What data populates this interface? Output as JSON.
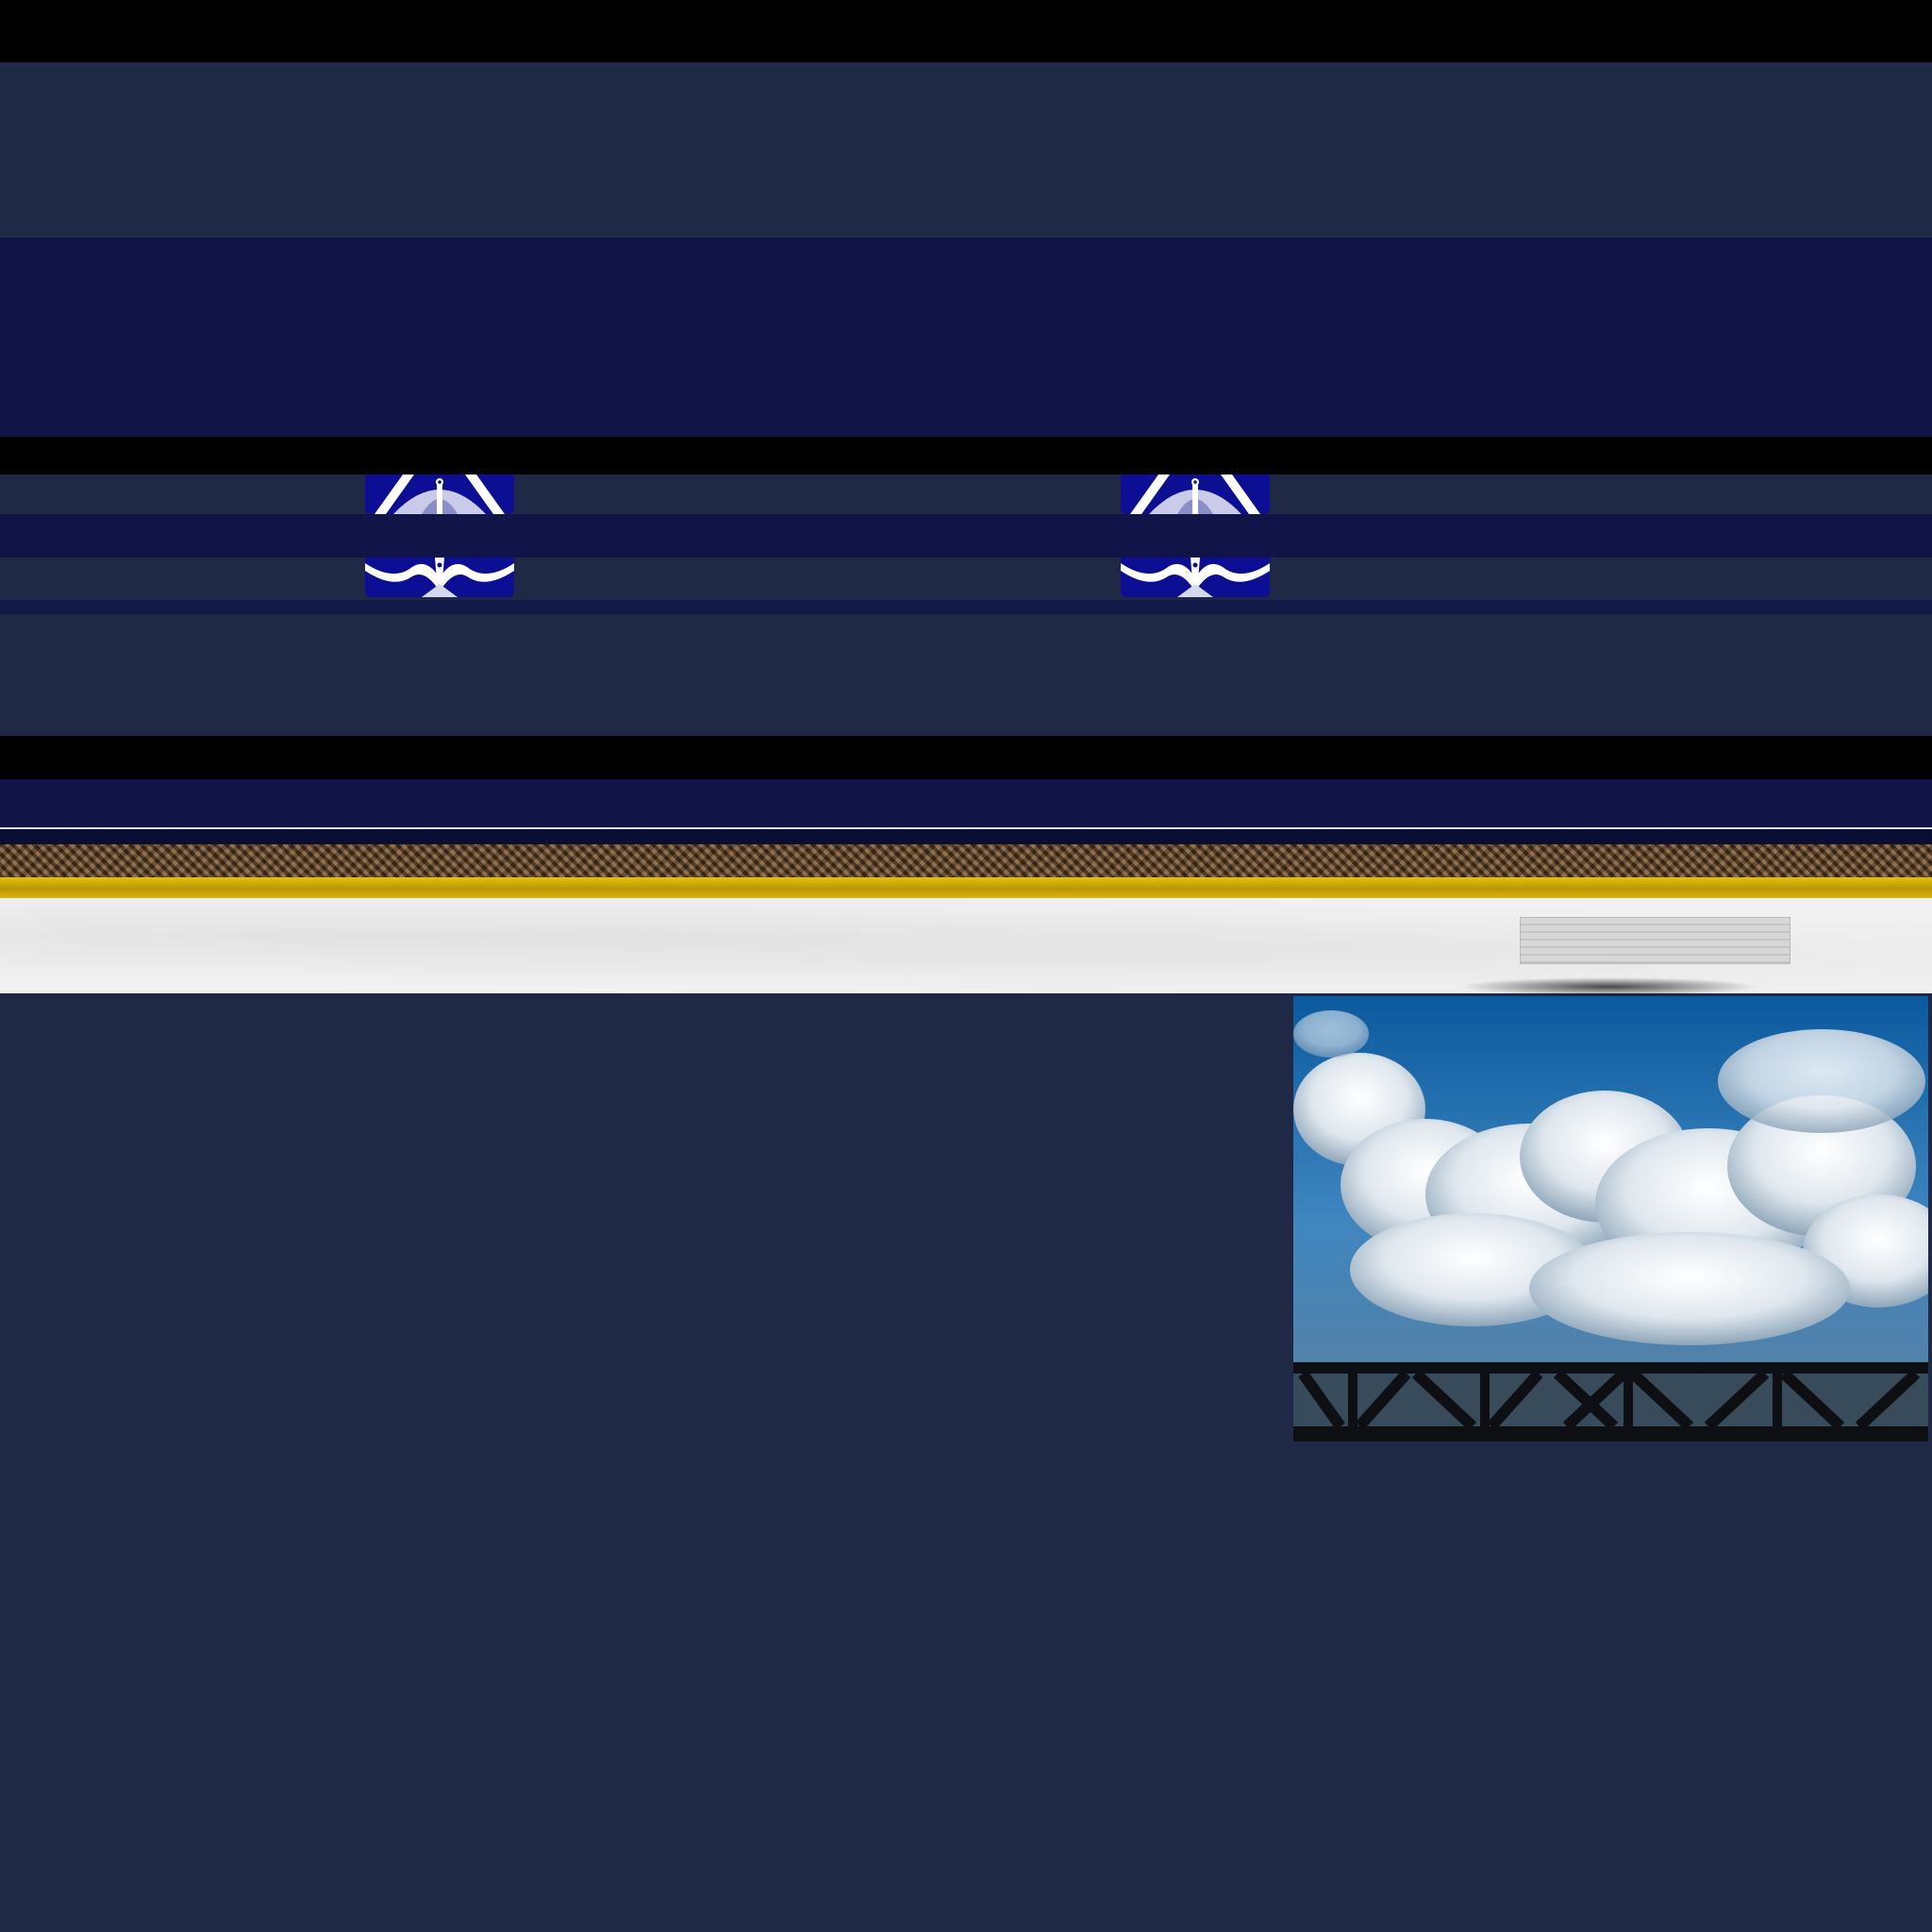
{
  "page": {
    "colors": {
      "background": "#1f2844",
      "deep_navy": "#101446",
      "black": "#000000",
      "gold": "#d9b40b",
      "bronze": "#6b4a2b",
      "paper": "#f1f1f1",
      "tile_blue": "#0c0f93"
    }
  },
  "header": {
    "ornament_icons": [
      "ornament-tile-icon",
      "ornament-tile-icon",
      "ornament-tile-icon",
      "ornament-tile-icon"
    ]
  },
  "toolbar": {
    "search_placeholder": ""
  },
  "banner": {
    "image": "clouds-over-bridge-photo"
  }
}
